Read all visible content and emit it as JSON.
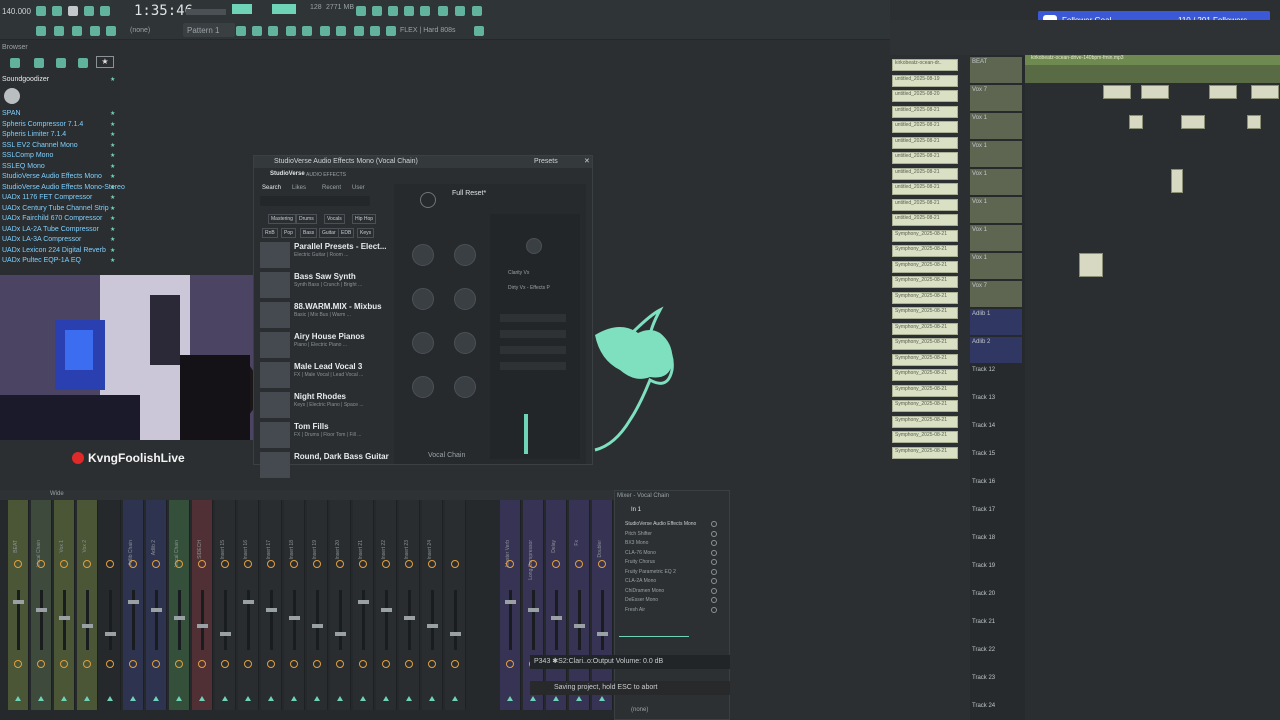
{
  "toolbar": {
    "tempo": "140.000",
    "time": "1:35:46",
    "pattern": "Pattern 1",
    "none_label": "(none)",
    "snap_label": "128",
    "memory": "2771 MB",
    "flex_info": "FLEX | Hard 808s"
  },
  "browser": {
    "title": "Browser",
    "items": [
      {
        "label": "Soundgoodizer"
      },
      {
        "label": "SPAN"
      },
      {
        "label": "Spheris Compressor 7.1.4"
      },
      {
        "label": "Spheris Limiter 7.1.4"
      },
      {
        "label": "SSL EV2 Channel Mono"
      },
      {
        "label": "SSLComp Mono"
      },
      {
        "label": "SSLEQ Mono"
      },
      {
        "label": "StudioVerse Audio Effects Mono"
      },
      {
        "label": "StudioVerse Audio Effects Mono-Stereo"
      },
      {
        "label": "UADx 1176 FET Compressor"
      },
      {
        "label": "UADx Century Tube Channel Strip"
      },
      {
        "label": "UADx Fairchild 670 Compressor"
      },
      {
        "label": "UADx LA-2A Tube Compressor"
      },
      {
        "label": "UADx LA-3A Compressor"
      },
      {
        "label": "UADx Lexicon 224 Digital Reverb"
      },
      {
        "label": "UADx Pultec EQP-1A EQ"
      }
    ]
  },
  "webcam": {
    "streamer": "KvngFoolishLive"
  },
  "plugin": {
    "window_title": "StudioVerse Audio Effects Mono (Vocal Chain)",
    "presets_label": "Presets",
    "brand": "StudioVerse",
    "brand_sub": "AUDIO EFFECTS",
    "tabs": [
      "Search",
      "Likes",
      "Recent",
      "User"
    ],
    "filters_row1": [
      "Mastering",
      "Drums",
      "Vocals",
      "Hip Hop"
    ],
    "filters_row2": [
      "RnB",
      "Pop",
      "Bass",
      "Guitar",
      "EDB",
      "Keys"
    ],
    "preset_name": "Full Reset*",
    "chain_label": "Vocal Chain",
    "slot1": "Clarity Vx",
    "slot2": "Dirty Vx - Effects P",
    "presets": [
      {
        "name": "Parallel Presets - Elect...",
        "sub": "Electric Guitar | Room ..."
      },
      {
        "name": "Bass Saw Synth",
        "sub": "Synth Bass | Crunch | Bright ..."
      },
      {
        "name": "88.WARM.MIX - Mixbus",
        "sub": "Basic | Mix Bus | Warm ..."
      },
      {
        "name": "Airy House Pianos",
        "sub": "Piano | Electric Piano ..."
      },
      {
        "name": "Male Lead Vocal 3",
        "sub": "FX | Male Vocal | Lead Vocal ..."
      },
      {
        "name": "Night Rhodes",
        "sub": "Keys | Electric Piano | Space ..."
      },
      {
        "name": "Tom Fills",
        "sub": "FX | Drums | Floor Tom | Fill ..."
      },
      {
        "name": "Round, Dark Bass Guitar",
        "sub": ""
      }
    ]
  },
  "follower": {
    "label": "Follower Goal",
    "count": "110 / 201 Followers"
  },
  "playlist": {
    "clip_label": "kirkobeatz-ocean-drive-140bpm-fmin.mp3",
    "clips": [
      "kirkobeatz-ocean-dr..",
      "untitled_2025-08-19",
      "untitled_2025-08-20",
      "untitled_2025-08-21",
      "untitled_2025-08-21",
      "untitled_2025-08-21",
      "untitled_2025-08-21",
      "untitled_2025-08-21",
      "untitled_2025-08-21",
      "untitled_2025-08-21",
      "untitled_2025-08-21",
      "Symphony_2025-08-21",
      "Symphony_2025-08-21",
      "Symphony_2025-08-21",
      "Symphony_2025-08-21",
      "Symphony_2025-08-21",
      "Symphony_2025-08-21",
      "Symphony_2025-08-21",
      "Symphony_2025-08-21",
      "Symphony_2025-08-21",
      "Symphony_2025-08-21",
      "Symphony_2025-08-21",
      "Symphony_2025-08-21",
      "Symphony_2025-08-21",
      "Symphony_2025-08-21",
      "Symphony_2025-08-21"
    ],
    "tracks": [
      "BEAT",
      "Vox 7",
      "Vox 1",
      "Vox 1",
      "Vox 1",
      "Vox 1",
      "Vox 1",
      "Vox 1",
      "Vox 7",
      "Adlib 1",
      "Adlib 2",
      "Track 12",
      "Track 13",
      "Track 14",
      "Track 15",
      "Track 16",
      "Track 17",
      "Track 18",
      "Track 19",
      "Track 20",
      "Track 21",
      "Track 22",
      "Track 23",
      "Track 24"
    ]
  },
  "mixer": {
    "title": "Wide",
    "fx_title": "Mixer - Vocal Chain",
    "input": "In 1",
    "strips": [
      "BEAT",
      "Vocal Chain",
      "Vox 1",
      "Vox 2",
      "",
      "Adlib Chain",
      "Adlib 2",
      "Vocal Chain",
      "SIDECH",
      "Insert 15",
      "Insert 16",
      "Insert 17",
      "Insert 18",
      "Insert 19",
      "Insert 20",
      "Insert 21",
      "Insert 22",
      "Insert 23",
      "Insert 24",
      "",
      "Master Verb",
      "Long Compressor",
      "Delay",
      "Fx",
      "Doubler"
    ],
    "fx_slots": [
      "StudioVerse Audio Effects Mono",
      "Pitch Shifter",
      "BX3 Mono",
      "CLA-76 Mono",
      "Fruity Chorus",
      "Fruity Parametric EQ 2",
      "CLA-2A Mono",
      "ChiDramen Mono",
      "DeEsser Mono",
      "Fresh Air"
    ],
    "out": "(none)"
  },
  "status": {
    "hint": "P343 ✱S2:Clari..o:Output Volume: 0.0 dB",
    "saving": "Saving project, hold ESC to abort"
  }
}
